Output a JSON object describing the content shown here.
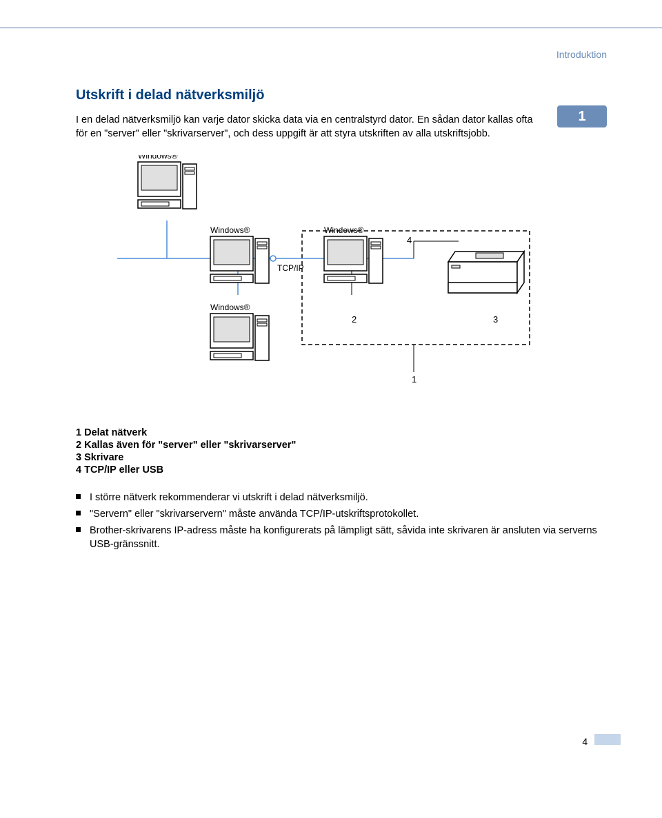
{
  "header": {
    "section": "Introduktion"
  },
  "chapter_tab": "1",
  "title": "Utskrift i delad nätverksmiljö",
  "intro": "I en delad nätverksmiljö kan varje dator skicka data via en centralstyrd dator. En sådan dator kallas ofta för en \"server\" eller \"skrivarserver\", och dess uppgift är att styra utskriften av alla utskriftsjobb.",
  "diagram": {
    "labels": {
      "os1": "Windows®",
      "os2": "Windows®",
      "os3": "Windows®",
      "os4": "Windows®",
      "protocol": "TCP/IP",
      "callout_1": "1",
      "callout_2": "2",
      "callout_3": "3",
      "callout_4": "4"
    }
  },
  "legend": {
    "items": [
      "1 Delat nätverk",
      "2 Kallas även för \"server\" eller \"skrivarserver\"",
      "3 Skrivare",
      "4 TCP/IP eller USB"
    ]
  },
  "bullets": {
    "items": [
      "I större nätverk rekommenderar vi utskrift i delad nätverksmiljö.",
      "\"Servern\" eller \"skrivarservern\" måste använda TCP/IP-utskriftsprotokollet.",
      "Brother-skrivarens IP-adress måste ha konfigurerats på lämpligt sätt, såvida inte skrivaren är ansluten via serverns USB-gränssnitt."
    ]
  },
  "footer": {
    "page": "4"
  }
}
